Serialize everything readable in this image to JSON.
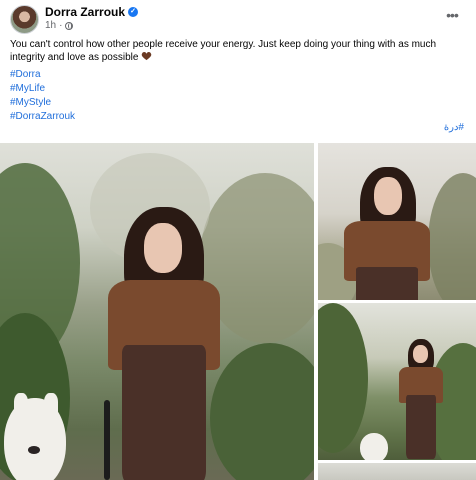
{
  "post": {
    "author": "Dorra Zarrouk",
    "time": "1h",
    "dot": "·",
    "text": "You can't control how other people receive your energy. Just keep doing your thing with as much integrity and love as possible",
    "hashtags": [
      "#Dorra",
      "#MyLife",
      "#MyStyle",
      "#DorraZarrouk"
    ],
    "rtl_tag": "#درة",
    "more_label": "•••"
  },
  "icons": {
    "avatar": "profile-avatar",
    "verified": "verified-badge-icon",
    "privacy": "globe-icon",
    "emoji": "brown-heart-emoji"
  },
  "colors": {
    "link": "#216fdb",
    "verified": "#1877f2",
    "meta": "#65676b"
  }
}
